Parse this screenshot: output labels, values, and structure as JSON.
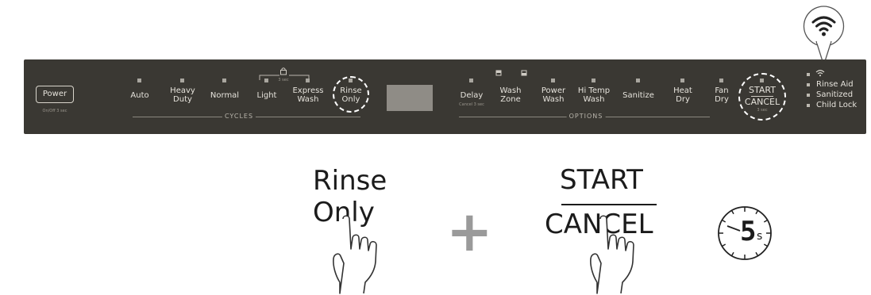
{
  "panel": {
    "power": {
      "label": "Power",
      "sublabel": "On/Off 3 sec"
    },
    "cycles": {
      "group_label": "CYCLES",
      "lock_hint": "3 sec",
      "items": [
        {
          "label": "Auto"
        },
        {
          "label": "Heavy\nDuty"
        },
        {
          "label": "Normal"
        },
        {
          "label": "Light"
        },
        {
          "label": "Express\nWash"
        },
        {
          "label": "Rinse\nOnly"
        }
      ]
    },
    "options": {
      "group_label": "OPTIONS",
      "items": [
        {
          "label": "Delay",
          "sublabel": "Cancel 3 sec"
        },
        {
          "label": "Wash\nZone"
        },
        {
          "label": "Power\nWash"
        },
        {
          "label": "Hi Temp\nWash"
        },
        {
          "label": "Sanitize"
        },
        {
          "label": "Heat\nDry"
        },
        {
          "label": "Fan\nDry"
        }
      ]
    },
    "start_cancel": {
      "label_top": "START",
      "label_bottom": "CANCEL",
      "sublabel": "3 sec"
    },
    "status": [
      "Rinse Aid",
      "Sanitized",
      "Child Lock"
    ]
  },
  "instruction": {
    "left_label": "Rinse\nOnly",
    "plus": "+",
    "right_top": "START",
    "right_bottom": "CANCEL",
    "timer_value": "5",
    "timer_unit": "s"
  },
  "icons": [
    "wifi-icon",
    "lock-icon",
    "hand-pointer-icon",
    "stopwatch-icon"
  ]
}
